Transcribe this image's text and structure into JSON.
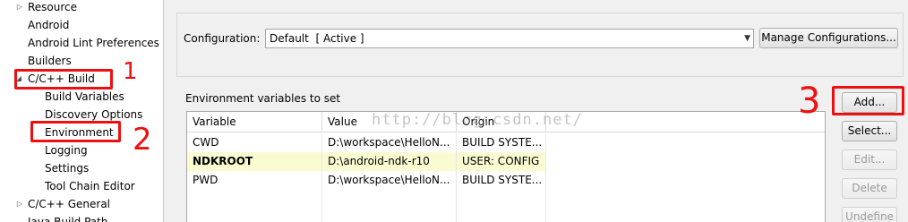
{
  "tree": {
    "items": [
      {
        "label": "Resource",
        "expander": "▷"
      },
      {
        "label": "Android"
      },
      {
        "label": "Android Lint Preferences"
      },
      {
        "label": "Builders"
      },
      {
        "label": "C/C++ Build",
        "expander": "◢"
      },
      {
        "label": "Build Variables"
      },
      {
        "label": "Discovery Options"
      },
      {
        "label": "Environment"
      },
      {
        "label": "Logging"
      },
      {
        "label": "Settings"
      },
      {
        "label": "Tool Chain Editor"
      },
      {
        "label": "C/C++ General",
        "expander": "▷"
      },
      {
        "label": "Java Build Path"
      }
    ]
  },
  "config": {
    "label": "Configuration:",
    "selected": "Default  [ Active ]",
    "manage_button": "Manage Configurations..."
  },
  "env": {
    "section_label": "Environment variables to set",
    "columns": [
      "Variable",
      "Value",
      "Origin"
    ],
    "rows": [
      {
        "variable": "CWD",
        "value": "D:\\workspace\\HelloN...",
        "origin": "BUILD SYSTE..."
      },
      {
        "variable": "NDKROOT",
        "value": "D:\\android-ndk-r10",
        "origin": "USER: CONFIG"
      },
      {
        "variable": "PWD",
        "value": "D:\\workspace\\HelloN...",
        "origin": "BUILD SYSTE..."
      }
    ]
  },
  "buttons": {
    "add": "Add...",
    "select": "Select...",
    "edit": "Edit...",
    "delete": "Delete",
    "undefine": "Undefine"
  },
  "annotations": {
    "mark1": "1",
    "mark2": "2",
    "mark3": "3",
    "color": "#ee1010"
  },
  "watermark": "http://blog.csdn.net/"
}
